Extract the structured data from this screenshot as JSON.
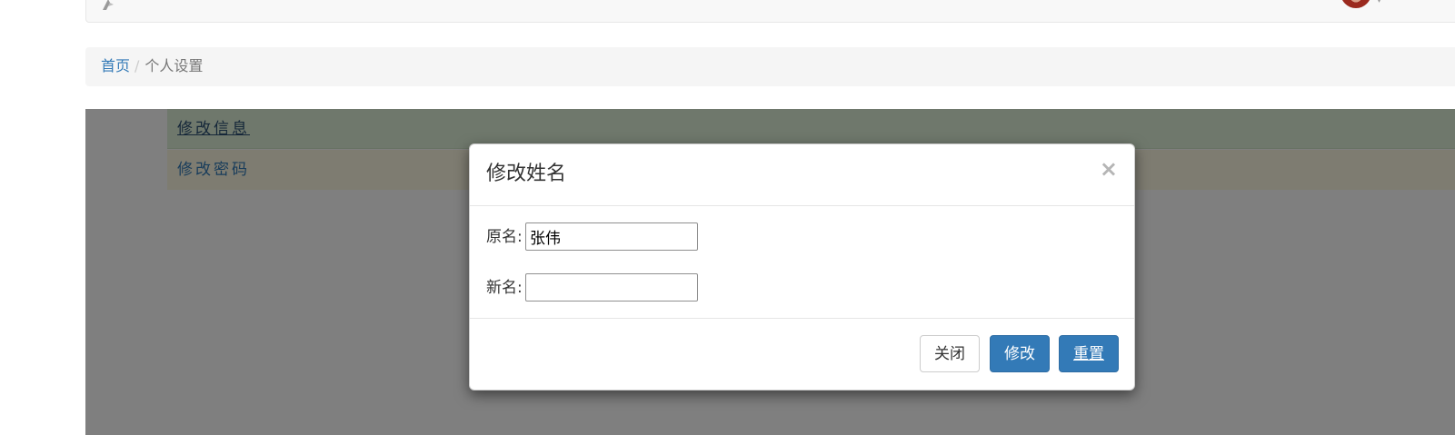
{
  "breadcrumb": {
    "home": "首页",
    "separator": "/",
    "current": "个人设置"
  },
  "menu": {
    "items": [
      {
        "label": "修改信息"
      },
      {
        "label": "修改密码"
      }
    ]
  },
  "modal": {
    "title": "修改姓名",
    "close_symbol": "×",
    "fields": {
      "original_label": "原名:",
      "original_value": "张伟",
      "new_label": "新名:",
      "new_value": ""
    },
    "buttons": {
      "close": "关闭",
      "modify": "修改",
      "reset": "重置"
    }
  },
  "colors": {
    "primary": "#337ab7",
    "menu_active_bg": "#dff0d8",
    "menu_warning_bg": "#fcf8e3",
    "backdrop": "rgba(0,0,0,0.5)"
  },
  "icons": {
    "brand": "brand-logo-icon",
    "avatar": "user-avatar",
    "caret": "caret-down-icon"
  }
}
